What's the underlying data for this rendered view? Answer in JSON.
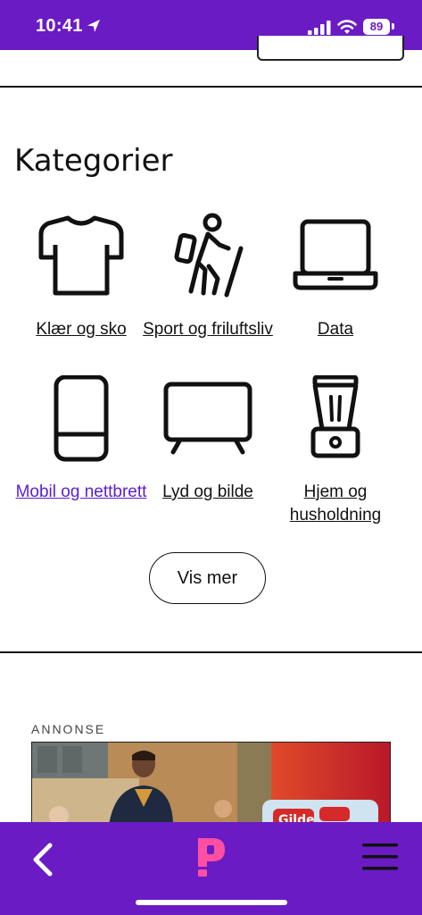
{
  "status_bar": {
    "time": "10:41",
    "battery": "89",
    "icons": [
      "location-arrow-icon",
      "signal-icon",
      "wifi-icon",
      "battery-icon"
    ]
  },
  "categories_section": {
    "title": "Kategorier",
    "items": [
      {
        "label": "Klær og sko",
        "icon": "tshirt-icon",
        "visited": false
      },
      {
        "label": "Sport og friluftsliv",
        "icon": "hiker-icon",
        "visited": false
      },
      {
        "label": "Data",
        "icon": "laptop-icon",
        "visited": false
      },
      {
        "label": "Mobil og nettbrett",
        "icon": "phone-icon",
        "visited": true
      },
      {
        "label": "Lyd og bilde",
        "icon": "tv-icon",
        "visited": false
      },
      {
        "label": "Hjem og husholdning",
        "icon": "blender-icon",
        "visited": false
      }
    ],
    "more_button": "Vis mer"
  },
  "ad": {
    "label": "ANNONSE",
    "brand_text": "Gilde"
  },
  "bottom_nav": {
    "icons": [
      "back-icon",
      "prisjakt-logo-icon",
      "menu-icon"
    ]
  },
  "colors": {
    "brand_purple": "#6a1bc4",
    "logo_pink": "#ff4fa3",
    "visited_link": "#5a1fd0"
  }
}
